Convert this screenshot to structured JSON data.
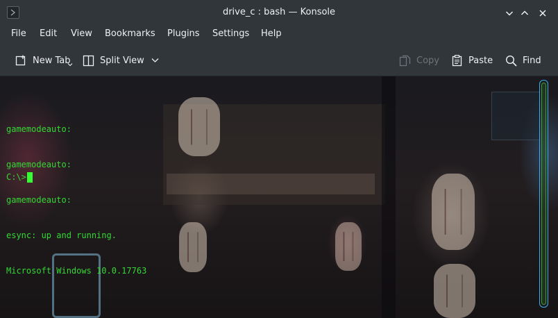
{
  "window": {
    "title": "drive_c : bash — Konsole",
    "icon": "terminal-icon",
    "controls": {
      "minimize": "chevron-down-icon",
      "maximize": "chevron-up-icon",
      "close": "close-icon"
    }
  },
  "menubar": {
    "items": [
      "File",
      "Edit",
      "View",
      "Bookmarks",
      "Plugins",
      "Settings",
      "Help"
    ]
  },
  "toolbar": {
    "new_tab": {
      "label": "New Tab",
      "icon": "new-tab-icon"
    },
    "split_view": {
      "label": "Split View",
      "icon": "split-view-icon"
    },
    "copy": {
      "label": "Copy",
      "icon": "copy-icon",
      "enabled": false
    },
    "paste": {
      "label": "Paste",
      "icon": "paste-icon"
    },
    "find": {
      "label": "Find",
      "icon": "search-icon"
    }
  },
  "terminal": {
    "lines": [
      "gamemodeauto:",
      "gamemodeauto:",
      "gamemodeauto:",
      "esync: up and running.",
      "Microsoft Windows 10.0.17763"
    ],
    "prompt": "C:\\>",
    "text_color": "#33d933"
  },
  "colors": {
    "chrome_bg": "#31363b",
    "accent": "#3daee9",
    "scroll_thumb": "#3f9e34"
  }
}
